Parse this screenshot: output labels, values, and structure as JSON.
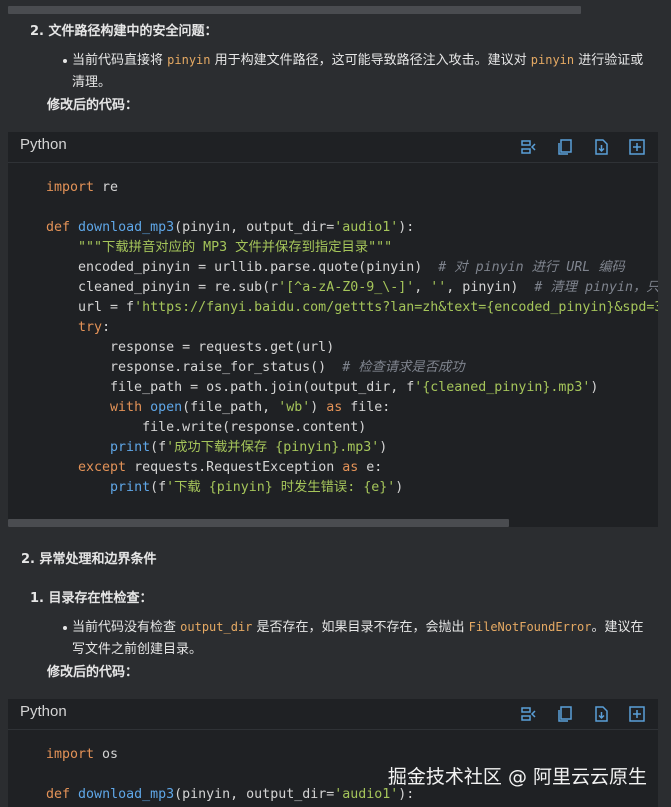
{
  "section1": {
    "heading_num": "2.",
    "heading": "文件路径构建中的安全问题：",
    "bullet_p1": "当前代码直接将 ",
    "bullet_code1": "pinyin",
    "bullet_p2": " 用于构建文件路径，这可能导致路径注入攻击。建议对 ",
    "bullet_code2": "pinyin",
    "bullet_p3": " 进行验证或",
    "bullet_line2": "清理。",
    "modified_label": "修改后的代码："
  },
  "code_block1": {
    "language": "Python",
    "lines": [
      [
        [
          "kw",
          "import"
        ],
        [
          "p",
          " re"
        ]
      ],
      [],
      [
        [
          "kw",
          "def"
        ],
        [
          "p",
          " "
        ],
        [
          "fn",
          "download_mp3"
        ],
        [
          "p",
          "(pinyin, output_dir="
        ],
        [
          "st",
          "'audio1'"
        ],
        [
          "p",
          "):"
        ]
      ],
      [
        [
          "p",
          "    "
        ],
        [
          "st",
          "\"\"\"下载拼音对应的 MP3 文件并保存到指定目录\"\"\""
        ]
      ],
      [
        [
          "p",
          "    encoded_pinyin = urllib.parse.quote(pinyin)  "
        ],
        [
          "cm",
          "# 对 pinyin 进行 URL 编码"
        ]
      ],
      [
        [
          "p",
          "    cleaned_pinyin = re.sub(r"
        ],
        [
          "st",
          "'[^a-zA-Z0-9_\\-]'"
        ],
        [
          "p",
          ", "
        ],
        [
          "st",
          "''"
        ],
        [
          "p",
          ", pinyin)  "
        ],
        [
          "cm",
          "# 清理 pinyin，只"
        ]
      ],
      [
        [
          "p",
          "    url = f"
        ],
        [
          "st",
          "'https://fanyi.baidu.com/gettts?lan=zh&text={encoded_pinyin}&spd=3"
        ]
      ],
      [
        [
          "p",
          "    "
        ],
        [
          "kw",
          "try"
        ],
        [
          "p",
          ":"
        ]
      ],
      [
        [
          "p",
          "        response = requests.get(url)"
        ]
      ],
      [
        [
          "p",
          "        response.raise_for_status()  "
        ],
        [
          "cm",
          "# 检查请求是否成功"
        ]
      ],
      [
        [
          "p",
          "        file_path = os.path.join(output_dir, f"
        ],
        [
          "st",
          "'{cleaned_pinyin}.mp3'"
        ],
        [
          "p",
          ")"
        ]
      ],
      [
        [
          "p",
          "        "
        ],
        [
          "kw",
          "with"
        ],
        [
          "p",
          " "
        ],
        [
          "fn",
          "open"
        ],
        [
          "p",
          "(file_path, "
        ],
        [
          "st",
          "'wb'"
        ],
        [
          "p",
          ") "
        ],
        [
          "kw",
          "as"
        ],
        [
          "p",
          " file:"
        ]
      ],
      [
        [
          "p",
          "            file.write(response.content)"
        ]
      ],
      [
        [
          "p",
          "        "
        ],
        [
          "fn",
          "print"
        ],
        [
          "p",
          "(f"
        ],
        [
          "st",
          "'成功下载并保存 {pinyin}.mp3'"
        ],
        [
          "p",
          ")"
        ]
      ],
      [
        [
          "p",
          "    "
        ],
        [
          "kw",
          "except"
        ],
        [
          "p",
          " requests.RequestException "
        ],
        [
          "kw",
          "as"
        ],
        [
          "p",
          " e:"
        ]
      ],
      [
        [
          "p",
          "        "
        ],
        [
          "fn",
          "print"
        ],
        [
          "p",
          "(f"
        ],
        [
          "st",
          "'下载 {pinyin} 时发生错误: {e}'"
        ],
        [
          "p",
          ")"
        ]
      ]
    ]
  },
  "section2": {
    "heading": "2. 异常处理和边界条件",
    "item_num": "1.",
    "item_heading": "目录存在性检查：",
    "bullet_p1": "当前代码没有检查 ",
    "bullet_code1": "output_dir",
    "bullet_p2": " 是否存在，如果目录不存在，会抛出 ",
    "bullet_code2": "FileNotFoundError",
    "bullet_p3": "。建议在",
    "bullet_line2": "写文件之前创建目录。",
    "modified_label": "修改后的代码："
  },
  "code_block2": {
    "language": "Python",
    "lines": [
      [
        [
          "kw",
          "import"
        ],
        [
          "p",
          " os"
        ]
      ],
      [],
      [
        [
          "kw",
          "def"
        ],
        [
          "p",
          " "
        ],
        [
          "fn",
          "download_mp3"
        ],
        [
          "p",
          "(pinyin, output_dir="
        ],
        [
          "st",
          "'audio1'"
        ],
        [
          "p",
          "):"
        ]
      ]
    ]
  },
  "toolbar_icons": [
    "wrap-toggle-icon",
    "copy-icon",
    "download-icon",
    "expand-icon"
  ],
  "scrollbars": {
    "top_thumb_fraction": 0.88,
    "code1_thumb_fraction": 0.77
  },
  "watermark": "掘金技术社区 @ 阿里云云原生"
}
